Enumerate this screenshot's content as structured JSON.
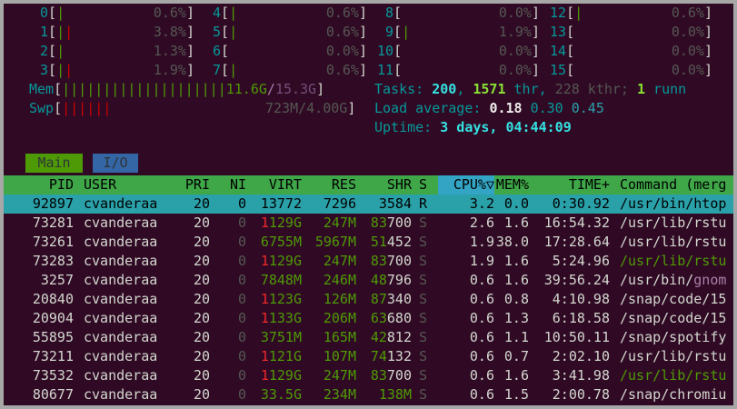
{
  "cpus": [
    {
      "id": "0",
      "bar": "|",
      "pct": "0.6%"
    },
    {
      "id": "1",
      "bar": "||",
      "pct": "3.8%"
    },
    {
      "id": "2",
      "bar": "|",
      "pct": "1.3%"
    },
    {
      "id": "3",
      "bar": "||",
      "pct": "1.9%"
    },
    {
      "id": "4",
      "bar": "|",
      "pct": "0.6%"
    },
    {
      "id": "5",
      "bar": "|",
      "pct": "0.6%"
    },
    {
      "id": "6",
      "bar": "",
      "pct": "0.0%"
    },
    {
      "id": "7",
      "bar": "|",
      "pct": "0.6%"
    },
    {
      "id": "8",
      "bar": "",
      "pct": "0.0%"
    },
    {
      "id": "9",
      "bar": "|",
      "pct": "1.9%"
    },
    {
      "id": "10",
      "bar": "",
      "pct": "0.0%"
    },
    {
      "id": "11",
      "bar": "",
      "pct": "0.0%"
    },
    {
      "id": "12",
      "bar": "|",
      "pct": "0.6%"
    },
    {
      "id": "13",
      "bar": "",
      "pct": "0.0%"
    },
    {
      "id": "14",
      "bar": "",
      "pct": "0.0%"
    },
    {
      "id": "15",
      "bar": "",
      "pct": "0.0%"
    }
  ],
  "mem": {
    "label": "Mem",
    "bar": "||||||||||||||||||||",
    "used": "11.6G",
    "sep": "/",
    "total": "15.3G"
  },
  "swp": {
    "label": "Swp",
    "bar": "||||||",
    "used": "723M",
    "sep": "/",
    "total": "4.00G"
  },
  "tasks": {
    "label": "Tasks: ",
    "count": "200",
    "sep1": ", ",
    "thr": "1571",
    "thr_label": " thr, ",
    "kthr": "228",
    "kthr_label": " kthr; ",
    "running": "1",
    "running_label": " runn"
  },
  "load": {
    "label": "Load average: ",
    "v1": "0.18",
    "v5": "0.30",
    "v15": "0.45"
  },
  "uptime": {
    "label": "Uptime: ",
    "value": "3 days, 04:44:09"
  },
  "tabs": {
    "main": "Main",
    "io": "I/O"
  },
  "columns": {
    "pid": "PID",
    "user": "USER",
    "pri": "PRI",
    "ni": "NI",
    "virt": "VIRT",
    "res": "RES",
    "shr": "SHR",
    "s": "S",
    "cpu": "CPU%▽",
    "mem": "MEM%",
    "time": "TIME+",
    "cmd": "Command (merg"
  },
  "processes": [
    {
      "pid": "92897",
      "user": "cvanderaa",
      "pri": "20",
      "ni": "0",
      "virt": "13772",
      "res": "7296",
      "shr": "3584",
      "s": "R",
      "cpu": "3.2",
      "mem": "0.0",
      "time": "0:30.92",
      "cmd": "/usr/bin/htop"
    },
    {
      "pid": "73281",
      "user": "cvanderaa",
      "pri": "20",
      "ni": "0",
      "virt": "1129G",
      "res": "247M",
      "shr": "83700",
      "s": "S",
      "cpu": "2.6",
      "mem": "1.6",
      "time": "16:54.32",
      "cmd": "/usr/lib/rstu"
    },
    {
      "pid": "73261",
      "user": "cvanderaa",
      "pri": "20",
      "ni": "0",
      "virt": "6755M",
      "res": "5967M",
      "shr": "51452",
      "s": "S",
      "cpu": "1.9",
      "mem": "38.0",
      "time": "17:28.64",
      "cmd": "/usr/lib/rstu"
    },
    {
      "pid": "73283",
      "user": "cvanderaa",
      "pri": "20",
      "ni": "0",
      "virt": "1129G",
      "res": "247M",
      "shr": "83700",
      "s": "S",
      "cpu": "1.9",
      "mem": "1.6",
      "time": "5:24.96",
      "cmd": "/usr/lib/rstu"
    },
    {
      "pid": "3257",
      "user": "cvanderaa",
      "pri": "20",
      "ni": "0",
      "virt": "7848M",
      "res": "246M",
      "shr": "48796",
      "s": "S",
      "cpu": "0.6",
      "mem": "1.6",
      "time": "39:56.24",
      "cmd": "/usr/bin/gnom"
    },
    {
      "pid": "20840",
      "user": "cvanderaa",
      "pri": "20",
      "ni": "0",
      "virt": "1123G",
      "res": "126M",
      "shr": "87340",
      "s": "S",
      "cpu": "0.6",
      "mem": "0.8",
      "time": "4:10.98",
      "cmd": "/snap/code/15"
    },
    {
      "pid": "20904",
      "user": "cvanderaa",
      "pri": "20",
      "ni": "0",
      "virt": "1133G",
      "res": "206M",
      "shr": "63680",
      "s": "S",
      "cpu": "0.6",
      "mem": "1.3",
      "time": "6:18.58",
      "cmd": "/snap/code/15"
    },
    {
      "pid": "55895",
      "user": "cvanderaa",
      "pri": "20",
      "ni": "0",
      "virt": "3751M",
      "res": "165M",
      "shr": "42812",
      "s": "S",
      "cpu": "0.6",
      "mem": "1.1",
      "time": "10:50.11",
      "cmd": "/snap/spotify"
    },
    {
      "pid": "73211",
      "user": "cvanderaa",
      "pri": "20",
      "ni": "0",
      "virt": "1121G",
      "res": "107M",
      "shr": "74132",
      "s": "S",
      "cpu": "0.6",
      "mem": "0.7",
      "time": "2:02.10",
      "cmd": "/usr/lib/rstu"
    },
    {
      "pid": "73532",
      "user": "cvanderaa",
      "pri": "20",
      "ni": "0",
      "virt": "1129G",
      "res": "247M",
      "shr": "83700",
      "s": "S",
      "cpu": "0.6",
      "mem": "1.6",
      "time": "3:41.98",
      "cmd": "/usr/lib/rstu"
    },
    {
      "pid": "80677",
      "user": "cvanderaa",
      "pri": "20",
      "ni": "0",
      "virt": "33.5G",
      "res": "234M",
      "shr": "138M",
      "s": "S",
      "cpu": "0.6",
      "mem": "1.5",
      "time": "2:00.78",
      "cmd": "/snap/chromiu"
    }
  ],
  "colors": {
    "bg": "#300a24",
    "header": "#3fa748",
    "selected_row": "#2aa0a9",
    "sort_col": "#34a4c4"
  }
}
